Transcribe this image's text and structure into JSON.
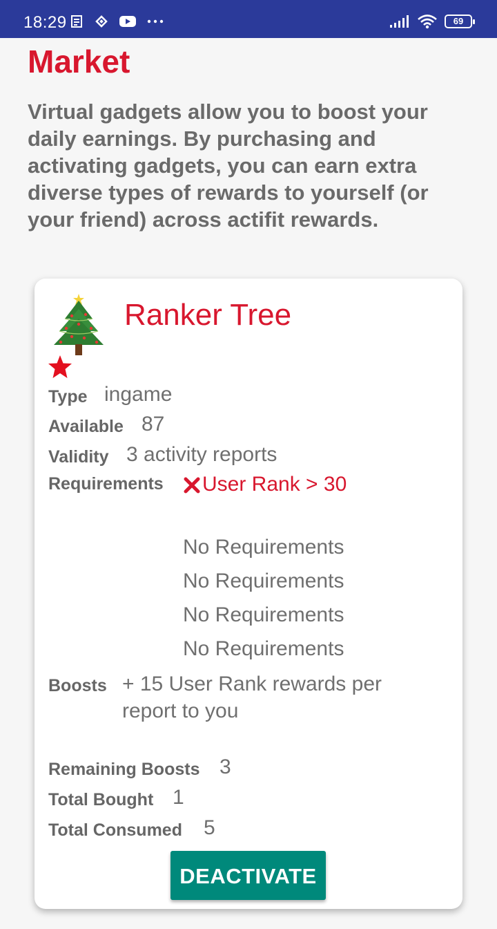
{
  "status_bar": {
    "time": "18:29",
    "battery": "69"
  },
  "page": {
    "title": "Market",
    "intro": "Virtual gadgets allow you to boost your daily earnings. By purchasing and activating gadgets, you can earn extra diverse types of rewards to yourself (or your friend) across actifit rewards."
  },
  "gadget": {
    "name": "Ranker Tree",
    "type_label": "Type",
    "type_value": "ingame",
    "available_label": "Available",
    "available_value": "87",
    "validity_label": "Validity",
    "validity_value": "3 activity reports",
    "requirements_label": "Requirements",
    "requirements": [
      {
        "text": "User Rank > 30",
        "met": false
      },
      {
        "text": "No Requirements",
        "met": true
      },
      {
        "text": "No Requirements",
        "met": true
      },
      {
        "text": "No Requirements",
        "met": true
      },
      {
        "text": "No Requirements",
        "met": true
      }
    ],
    "boosts_label": "Boosts",
    "boosts_value": "+ 15 User Rank rewards per report to you",
    "remaining_label": "Remaining Boosts",
    "remaining_value": "3",
    "bought_label": "Total Bought",
    "bought_value": "1",
    "consumed_label": "Total Consumed",
    "consumed_value": "5",
    "action_label": "DEACTIVATE"
  },
  "colors": {
    "accent_red": "#d8172e",
    "button_teal": "#00897b",
    "status_bar": "#2b3a9a"
  },
  "icons": [
    "christmas-tree-icon",
    "star-icon",
    "cross-icon",
    "wifi-icon",
    "signal-icon",
    "youtube-icon"
  ]
}
